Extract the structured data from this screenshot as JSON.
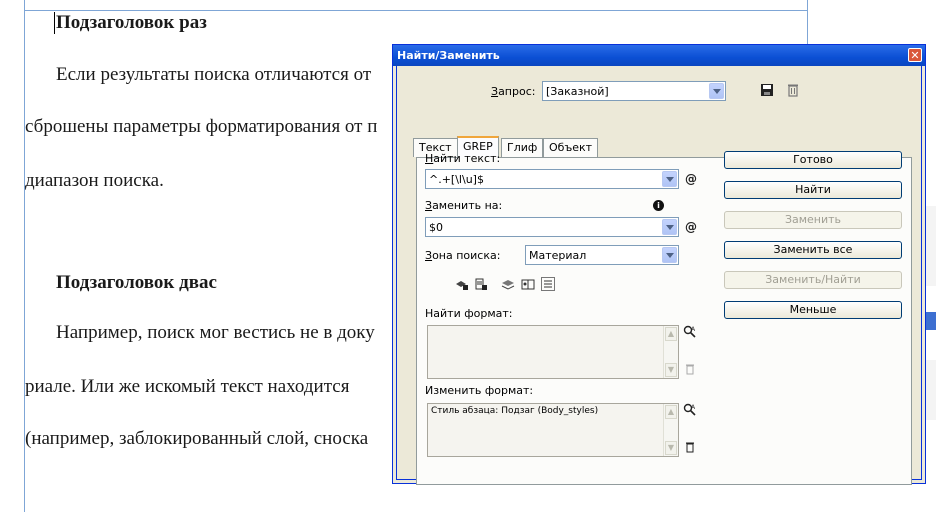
{
  "document": {
    "lines": [
      {
        "text": "Подзаголовок раз",
        "bold": true
      },
      {
        "text": "Если результаты поиска отличаются от",
        "bold": false
      },
      {
        "text": "сброшены параметры форматирования от п",
        "bold": false
      },
      {
        "text": "диапазон поиска.",
        "bold": false
      },
      {
        "text": "Подзаголовок двас",
        "bold": true
      },
      {
        "text": "Например, поиск мог вестись не в доку",
        "bold": false
      },
      {
        "text": "риале. Или же искомый текст находится",
        "bold": false
      },
      {
        "text": "(например, заблокированный слой, сноска",
        "bold": false
      }
    ]
  },
  "dialog": {
    "title": "Найти/Заменить",
    "close_glyph": "✕",
    "query": {
      "label_prefix": "",
      "label_u": "З",
      "label_rest": "апрос:",
      "value": "[Заказной]"
    },
    "tabs": [
      "Текст",
      "GREP",
      "Глиф",
      "Объект"
    ],
    "active_tab": "GREP",
    "find": {
      "label_u": "Н",
      "label_rest": "айти текст:",
      "value": "^.+[\\l\\u]$"
    },
    "replace": {
      "label_u": "З",
      "label_rest": "аменить на:",
      "value": "$0"
    },
    "zone": {
      "label_u": "З",
      "label_rest": "она поиска:",
      "value": "Материал"
    },
    "find_format": {
      "label": "Найти формат:",
      "value": ""
    },
    "change_format": {
      "label": "Изменить формат:",
      "value": "Стиль абзаца: Подзаг (Body_styles)"
    },
    "buttons": {
      "done": "Готово",
      "find": "Найти",
      "replace": "Заменить",
      "replace_all": "Заменить все",
      "replace_find": "Заменить/Найти",
      "less": "Меньше"
    },
    "at_glyph": "@",
    "info_glyph": "i"
  }
}
